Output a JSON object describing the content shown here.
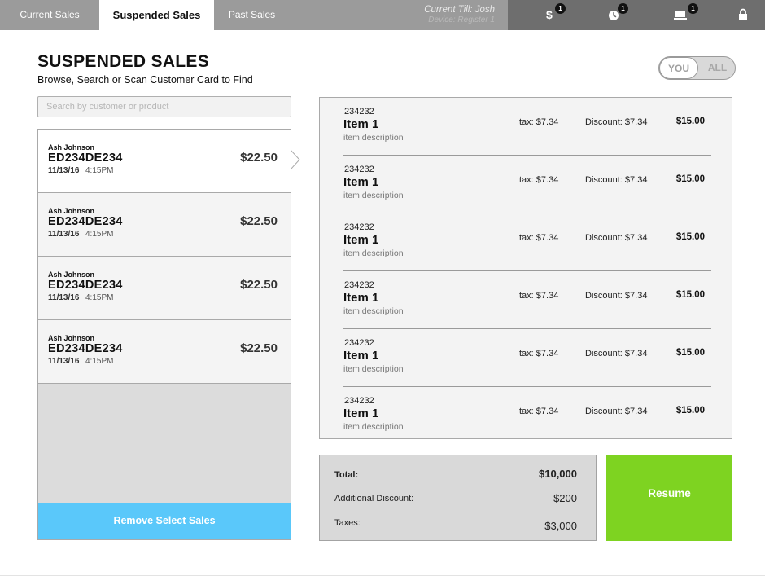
{
  "tabs": [
    {
      "label": "Current Sales",
      "active": false
    },
    {
      "label": "Suspended Sales",
      "active": true
    },
    {
      "label": "Past Sales",
      "active": false
    }
  ],
  "status": {
    "till": "Current Till: Josh",
    "device": "Device: Register 1",
    "icons": [
      {
        "icon": "dollar-icon",
        "badge": "1"
      },
      {
        "icon": "clock-icon",
        "badge": "1"
      },
      {
        "icon": "laptop-icon",
        "badge": "1"
      },
      {
        "icon": "lock-icon",
        "badge": ""
      }
    ]
  },
  "page": {
    "title": "SUSPENDED SALES",
    "subtitle": "Browse, Search or Scan Customer Card to Find"
  },
  "toggle": {
    "you": "YOU",
    "all": "ALL",
    "selected": "YOU"
  },
  "search": {
    "placeholder": "Search by customer or product",
    "value": ""
  },
  "sales": [
    {
      "customer": "Ash Johnson",
      "code": "ED234DE234",
      "date": "11/13/16",
      "time": "4:15PM",
      "amount": "$22.50",
      "selected": true
    },
    {
      "customer": "Ash Johnson",
      "code": "ED234DE234",
      "date": "11/13/16",
      "time": "4:15PM",
      "amount": "$22.50",
      "selected": false
    },
    {
      "customer": "Ash Johnson",
      "code": "ED234DE234",
      "date": "11/13/16",
      "time": "4:15PM",
      "amount": "$22.50",
      "selected": false
    },
    {
      "customer": "Ash Johnson",
      "code": "ED234DE234",
      "date": "11/13/16",
      "time": "4:15PM",
      "amount": "$22.50",
      "selected": false
    }
  ],
  "remove_label": "Remove Select Sales",
  "items": [
    {
      "sku": "234232",
      "name": "Item 1",
      "description": "item description",
      "tax": "tax: $7.34",
      "discount": "Discount: $7.34",
      "price": "$15.00"
    },
    {
      "sku": "234232",
      "name": "Item 1",
      "description": "item description",
      "tax": "tax: $7.34",
      "discount": "Discount: $7.34",
      "price": "$15.00"
    },
    {
      "sku": "234232",
      "name": "Item 1",
      "description": "item description",
      "tax": "tax: $7.34",
      "discount": "Discount: $7.34",
      "price": "$15.00"
    },
    {
      "sku": "234232",
      "name": "Item 1",
      "description": "item description",
      "tax": "tax: $7.34",
      "discount": "Discount: $7.34",
      "price": "$15.00"
    },
    {
      "sku": "234232",
      "name": "Item 1",
      "description": "item description",
      "tax": "tax: $7.34",
      "discount": "Discount: $7.34",
      "price": "$15.00"
    },
    {
      "sku": "234232",
      "name": "Item 1",
      "description": "item description",
      "tax": "tax: $7.34",
      "discount": "Discount: $7.34",
      "price": "$15.00"
    }
  ],
  "totals": {
    "total_label": "Total:",
    "total_value": "$10,000",
    "discount_label": "Additional Discount:",
    "discount_value": "$200",
    "taxes_label": "Taxes:",
    "taxes_value": "$3,000"
  },
  "resume_label": "Resume",
  "colors": {
    "remove_button": "#5ac8fa",
    "resume_button": "#7ed321"
  }
}
